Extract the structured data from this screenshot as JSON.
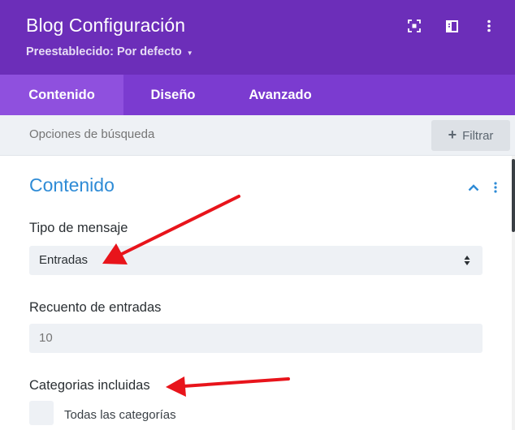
{
  "header": {
    "title": "Blog Configuración",
    "preset_label": "Preestablecido: Por defecto",
    "icons": [
      "focus-icon",
      "split-view-icon",
      "more-vertical-icon"
    ],
    "background_color": "#6c2eb9"
  },
  "tabs": [
    {
      "label": "Contenido",
      "active": true
    },
    {
      "label": "Diseño",
      "active": false
    },
    {
      "label": "Avanzado",
      "active": false
    }
  ],
  "search": {
    "placeholder": "Opciones de búsqueda",
    "filter_label": "Filtrar"
  },
  "section": {
    "title": "Contenido",
    "title_color": "#2e8bd6",
    "fields": {
      "post_type": {
        "label": "Tipo de mensaje",
        "value": "Entradas"
      },
      "post_count": {
        "label": "Recuento de entradas",
        "placeholder": "10"
      },
      "categories": {
        "label": "Categorias incluidas",
        "option_label": "Todas las categorías"
      }
    }
  },
  "annotation_color": "#e8141b"
}
